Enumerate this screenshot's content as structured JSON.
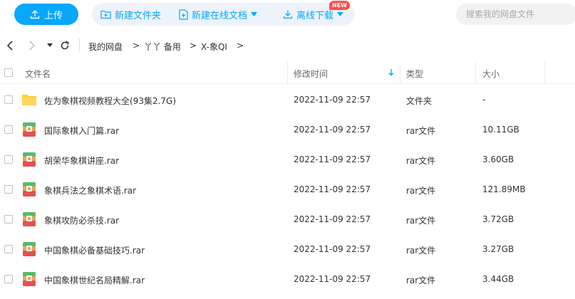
{
  "toolbar": {
    "upload_label": "上传",
    "new_folder_label": "新建文件夹",
    "new_online_doc_label": "新建在线文档",
    "new_badge": "NEW",
    "offline_download_label": "离线下载",
    "search_placeholder": "搜索我的网盘文件",
    "accent": "#06a7ff"
  },
  "breadcrumb": [
    {
      "label": "我的网盘"
    },
    {
      "label": "丫丫 备用"
    },
    {
      "label": "X-象QI"
    }
  ],
  "table": {
    "headers": {
      "name": "文件名",
      "modified": "修改时间",
      "type": "类型",
      "size": "大小"
    },
    "sort_icon": "arrow-down-icon",
    "rows": [
      {
        "icon": "folder-icon",
        "name": "佐为象棋视频教程大全(93集2.7G)",
        "modified": "2022-11-09 22:57",
        "type": "文件夹",
        "size": "-"
      },
      {
        "icon": "rar-icon",
        "name": "国际象棋入门篇.rar",
        "modified": "2022-11-09 22:57",
        "type": "rar文件",
        "size": "10.11GB"
      },
      {
        "icon": "rar-icon",
        "name": "胡荣华象棋讲座.rar",
        "modified": "2022-11-09 22:57",
        "type": "rar文件",
        "size": "3.60GB"
      },
      {
        "icon": "rar-icon",
        "name": "象棋兵法之象棋术语.rar",
        "modified": "2022-11-09 22:57",
        "type": "rar文件",
        "size": "121.89MB"
      },
      {
        "icon": "rar-icon",
        "name": "象棋攻防必杀技.rar",
        "modified": "2022-11-09 22:57",
        "type": "rar文件",
        "size": "3.72GB"
      },
      {
        "icon": "rar-icon",
        "name": "中国象棋必备基础技巧.rar",
        "modified": "2022-11-09 22:57",
        "type": "rar文件",
        "size": "3.27GB"
      },
      {
        "icon": "rar-icon",
        "name": "中国象棋世纪名局精解.rar",
        "modified": "2022-11-09 22:57",
        "type": "rar文件",
        "size": "3.44GB"
      }
    ]
  }
}
